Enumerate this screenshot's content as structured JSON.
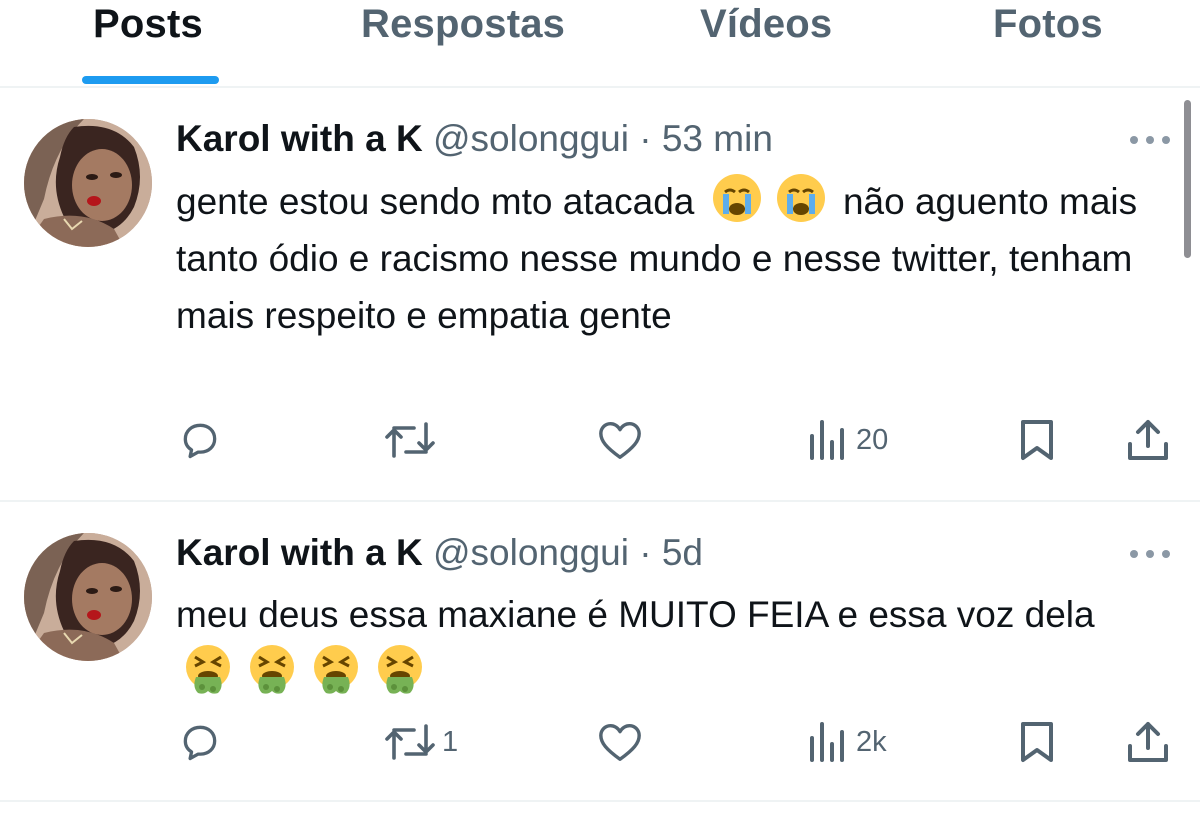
{
  "tabs": [
    {
      "label": "Posts",
      "active": true
    },
    {
      "label": "Respostas",
      "active": false
    },
    {
      "label": "Vídeos",
      "active": false
    },
    {
      "label": "Fotos",
      "active": false
    }
  ],
  "colors": {
    "accent": "#1d9bf0",
    "text_primary": "#0f1419",
    "text_secondary": "#536471",
    "divider": "#eff3f4"
  },
  "tweets": [
    {
      "author_name": "Karol with a K",
      "handle": "@solonggui",
      "separator": "·",
      "time": "53 min",
      "text_before_emoji": "gente estou sendo mto atacada",
      "emoji": [
        "loudly-crying-face",
        "loudly-crying-face"
      ],
      "text_after_emoji": "não aguento mais tanto ódio e racismo nesse mundo e nesse twitter, tenham mais respeito e empatia gente",
      "actions": {
        "reply": "",
        "repost": "",
        "like": "",
        "views": "20"
      }
    },
    {
      "author_name": "Karol with a K",
      "handle": "@solonggui",
      "separator": "·",
      "time": "5d",
      "text_before_emoji": "meu deus essa maxiane é MUITO FEIA e essa voz dela",
      "emoji": [
        "face-vomiting",
        "face-vomiting",
        "face-vomiting",
        "face-vomiting"
      ],
      "text_after_emoji": "",
      "actions": {
        "reply": "",
        "repost": "1",
        "like": "",
        "views": "2k"
      }
    }
  ]
}
